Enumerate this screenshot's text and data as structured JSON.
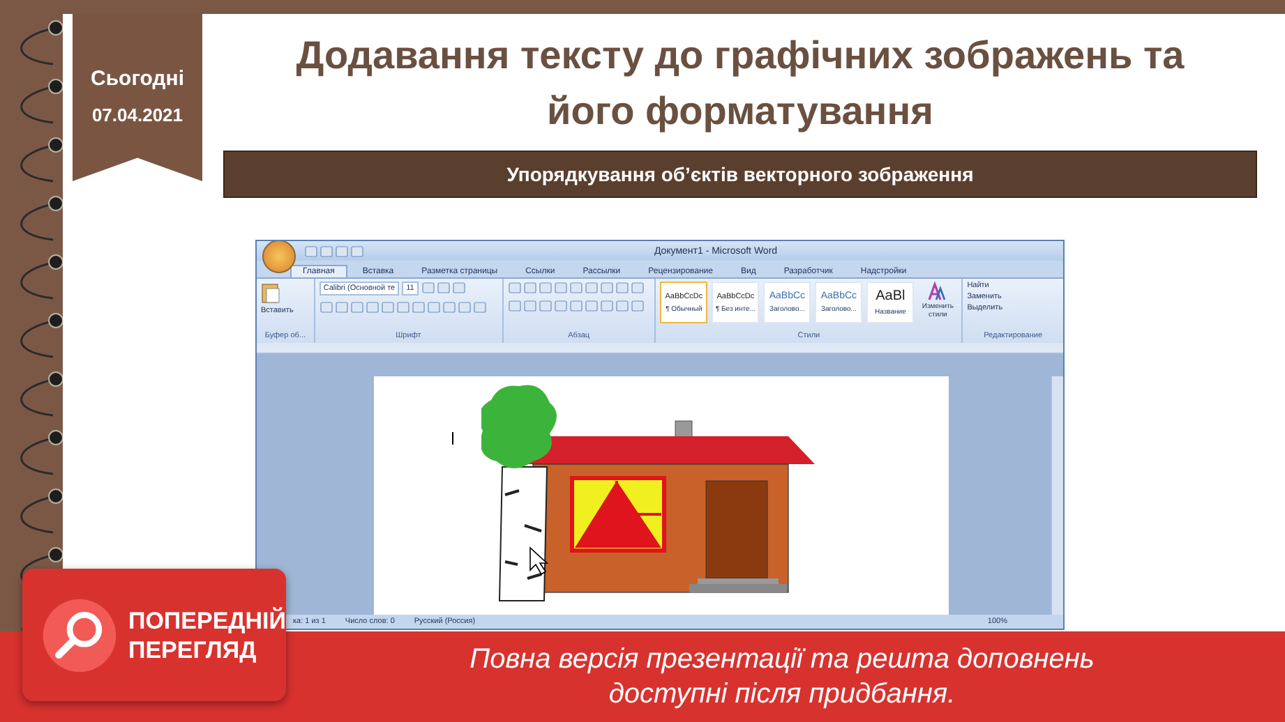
{
  "date_tag": {
    "label": "Сьогодні",
    "date": "07.04.2021"
  },
  "title": "Додавання тексту до графічних зображень та його форматування",
  "subtitle": "Упорядкування об’єктів векторного зображення",
  "word_window": {
    "title": "Документ1 - Microsoft Word",
    "tabs": [
      {
        "label": "Главная",
        "selected": true
      },
      {
        "label": "Вставка",
        "selected": false
      },
      {
        "label": "Разметка страницы",
        "selected": false
      },
      {
        "label": "Ссылки",
        "selected": false
      },
      {
        "label": "Рассылки",
        "selected": false
      },
      {
        "label": "Рецензирование",
        "selected": false
      },
      {
        "label": "Вид",
        "selected": false
      },
      {
        "label": "Разработчик",
        "selected": false
      },
      {
        "label": "Надстройки",
        "selected": false
      }
    ],
    "clipboard": {
      "paste": "Вставить",
      "label": "Буфер об..."
    },
    "font": {
      "name": "Calibri (Основной те",
      "size": "11",
      "label": "Шрифт"
    },
    "paragraph": {
      "label": "Абзац"
    },
    "styles": {
      "items": [
        {
          "sample": "AaBbCcDc",
          "name": "¶ Обычный",
          "kind": "normal",
          "selected": true
        },
        {
          "sample": "AaBbCcDc",
          "name": "¶ Без инте...",
          "kind": "normal",
          "selected": false
        },
        {
          "sample": "AaBbCc",
          "name": "Заголово...",
          "kind": "heading",
          "selected": false
        },
        {
          "sample": "AaBbCc",
          "name": "Заголово...",
          "kind": "heading",
          "selected": false
        },
        {
          "sample": "AaBl",
          "name": "Название",
          "kind": "title",
          "selected": false
        }
      ],
      "change": "Изменить стили",
      "label": "Стили"
    },
    "editing": {
      "items": [
        "Найти",
        "Заменить",
        "Выделить"
      ],
      "label": "Редактирование"
    },
    "status_bar": [
      "ка: 1 из 1",
      "Число слов: 0",
      "Русский (Россия)",
      "100%"
    ]
  },
  "preview_badge": {
    "line1": "ПОПЕРЕДНІЙ",
    "line2": "ПЕРЕГЛЯД"
  },
  "banner": {
    "text": "Повна версія презентації та решта доповнень доступні після придбання."
  }
}
